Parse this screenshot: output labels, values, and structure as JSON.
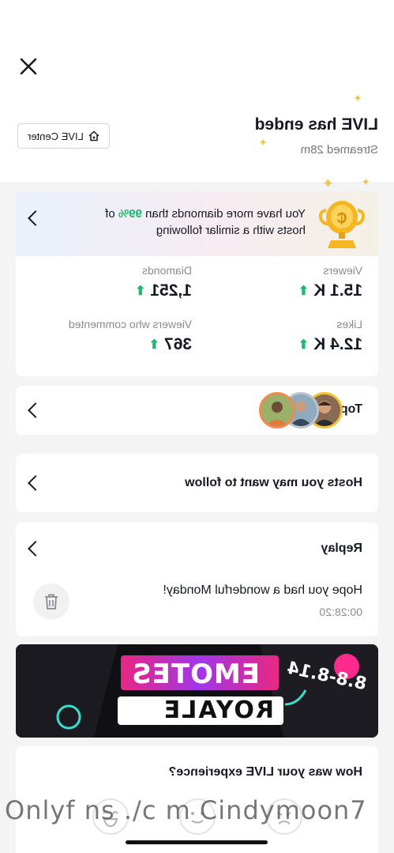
{
  "header": {
    "title": "LIVE has ended",
    "subtitle": "Streamed 28m",
    "live_center_label": "LIVE Center"
  },
  "banner": {
    "text_before": "You have more diamonds than ",
    "percent": "99%",
    "text_after": " of hosts with a similar following"
  },
  "stats": {
    "viewers_label": "Viewers",
    "viewers_value": "15.1 K",
    "diamonds_label": "Diamonds",
    "diamonds_value": "1,251",
    "likes_label": "Likes",
    "likes_value": "12.4 K",
    "commenters_label": "Viewers who commented",
    "commenters_value": "367"
  },
  "top_viewers": {
    "label": "Top viewers"
  },
  "hosts_follow": {
    "label": "Hosts you may want to follow"
  },
  "replay": {
    "label": "Replay",
    "title": "Hope you had a wonderful Monday!",
    "duration": "00:28:20"
  },
  "promo": {
    "line1": "EMOTES",
    "line2": "ROYALE",
    "date": "8.8-8.14"
  },
  "experience": {
    "title": "How was your LIVE experience?"
  },
  "watermark": "Onlyf ns ./c m Cindymoon7",
  "colors": {
    "accent_green": "#1fb86a",
    "trophy_gold": "#f5b622",
    "promo_pink": "#ff2a8e"
  }
}
